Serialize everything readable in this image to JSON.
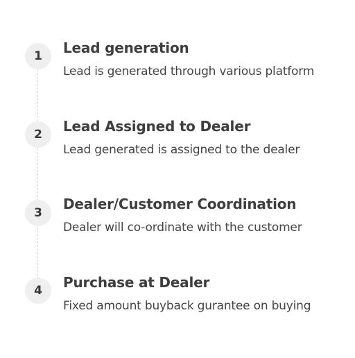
{
  "steps": [
    {
      "number": "1",
      "title": "Lead generation",
      "description": "Lead is generated through various platform"
    },
    {
      "number": "2",
      "title": "Lead Assigned to Dealer",
      "description": "Lead generated is assigned to the dealer"
    },
    {
      "number": "3",
      "title": "Dealer/Customer Coordination",
      "description": "Dealer will co-ordinate with the customer"
    },
    {
      "number": "4",
      "title": "Purchase at Dealer",
      "description": "Fixed amount buyback gurantee on buying"
    }
  ]
}
